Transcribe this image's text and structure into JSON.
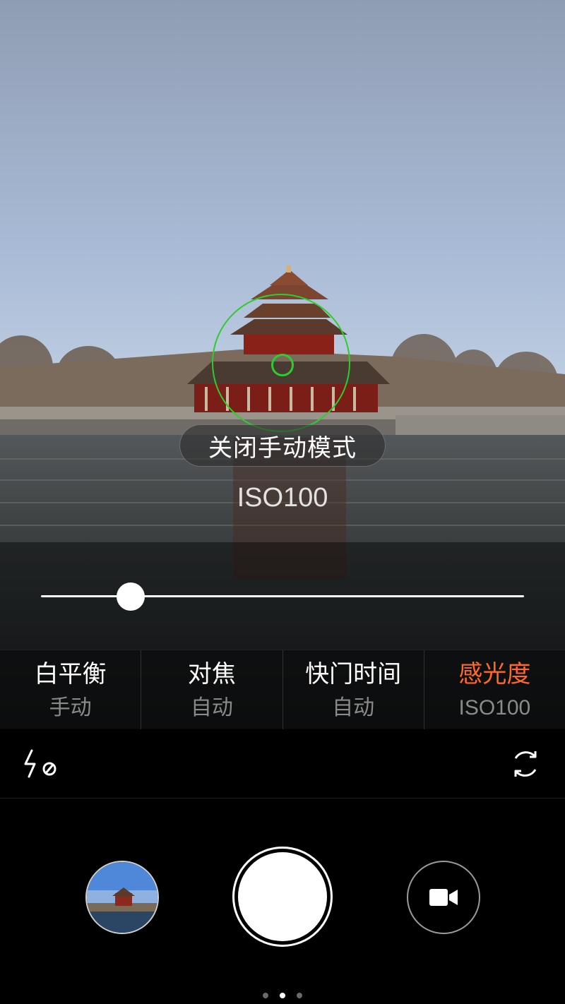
{
  "overlay": {
    "exit_manual_label": "关闭手动模式",
    "current_value": "ISO100"
  },
  "slider": {
    "value_fraction": 0.186
  },
  "params": [
    {
      "label": "白平衡",
      "value": "手动"
    },
    {
      "label": "对焦",
      "value": "自动"
    },
    {
      "label": "快门时间",
      "value": "自动"
    },
    {
      "label": "感光度",
      "value": "ISO100",
      "active": true
    }
  ],
  "toolbar": {
    "flash_icon": "flash-off-icon",
    "switch_icon": "switch-camera-icon"
  },
  "controls": {
    "gallery_icon": "gallery-thumbnail",
    "shutter_icon": "shutter-button",
    "video_icon": "video-camera-icon"
  },
  "pager": {
    "count": 3,
    "active_index": 1
  },
  "colors": {
    "accent": "#ff6a23",
    "focus": "#2ecc2e"
  }
}
